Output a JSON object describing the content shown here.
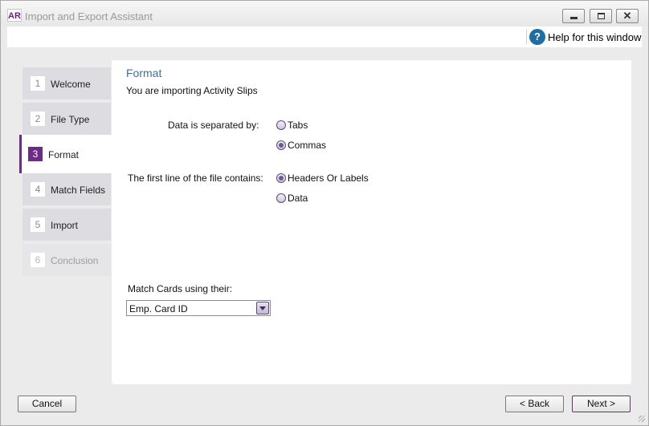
{
  "window": {
    "logo": "AR",
    "title": "Import and Export Assistant",
    "close_glyph": "✕"
  },
  "help": {
    "icon": "?",
    "label": "Help for this window"
  },
  "steps": [
    {
      "num": "1",
      "label": "Welcome",
      "state": "normal"
    },
    {
      "num": "2",
      "label": "File Type",
      "state": "normal"
    },
    {
      "num": "3",
      "label": "Format",
      "state": "active"
    },
    {
      "num": "4",
      "label": "Match Fields",
      "state": "normal"
    },
    {
      "num": "5",
      "label": "Import",
      "state": "normal"
    },
    {
      "num": "6",
      "label": "Conclusion",
      "state": "disabled"
    }
  ],
  "content": {
    "heading": "Format",
    "subtitle": "You are importing Activity Slips",
    "separator": {
      "label": "Data is separated by:",
      "options": [
        {
          "label": "Tabs",
          "selected": false
        },
        {
          "label": "Commas",
          "selected": true
        }
      ]
    },
    "first_line": {
      "label": "The first line of the file contains:",
      "options": [
        {
          "label": "Headers Or Labels",
          "selected": true
        },
        {
          "label": "Data",
          "selected": false
        }
      ]
    },
    "match_cards": {
      "label": "Match Cards using their:",
      "value": "Emp. Card ID"
    }
  },
  "buttons": {
    "cancel": "Cancel",
    "back": "< Back",
    "next": "Next >"
  },
  "colors": {
    "accent": "#6b2b86",
    "heading": "#3d6fa3",
    "help_icon": "#1c6ea4"
  }
}
